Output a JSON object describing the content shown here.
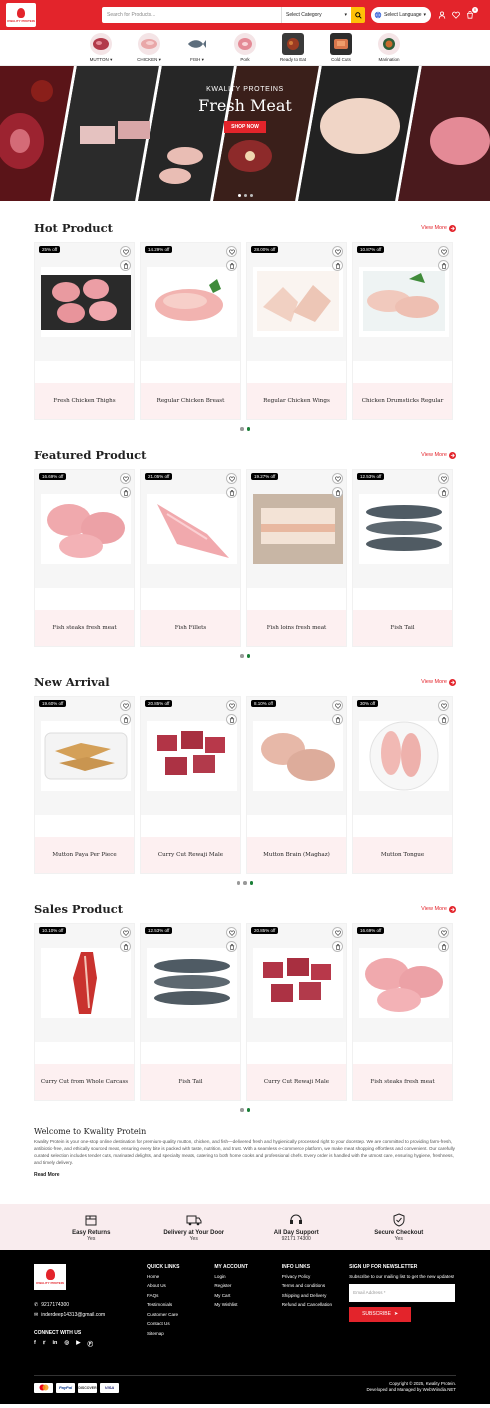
{
  "header": {
    "logo_text": "KWALITY PROTEIN",
    "search_placeholder": "Search for Products...",
    "category_select": "Select Category",
    "language_select": "Select Language",
    "cart_count": "0"
  },
  "categories": [
    {
      "label": "MUTTON"
    },
    {
      "label": "CHICKEN"
    },
    {
      "label": "FISH"
    },
    {
      "label": "Pork"
    },
    {
      "label": "Ready to Eat"
    },
    {
      "label": "Cold Cuts"
    },
    {
      "label": "Marination"
    }
  ],
  "hero": {
    "subtitle": "KWALITY PROTEINS",
    "title": "Fresh Meat",
    "button": "SHOP NOW"
  },
  "sections": [
    {
      "title": "Hot Product",
      "view_more": "View More",
      "products": [
        {
          "badge": "25% off",
          "name": "Fresh Chicken Thighs"
        },
        {
          "badge": "14.29% off",
          "name": "Regular Chicken Breast"
        },
        {
          "badge": "28.00% off",
          "name": "Regular Chicken Wings"
        },
        {
          "badge": "10.87% off",
          "name": "Chicken Drumsticks Regular"
        }
      ]
    },
    {
      "title": "Featured Product",
      "view_more": "View More",
      "products": [
        {
          "badge": "16.69% off",
          "name": "Fish steaks fresh meat"
        },
        {
          "badge": "21.05% off",
          "name": "Fish Fillets"
        },
        {
          "badge": "19.27% off",
          "name": "Fish loins fresh meat"
        },
        {
          "badge": "12.53% off",
          "name": "Fish Tail"
        }
      ]
    },
    {
      "title": "New Arrival",
      "view_more": "View More",
      "products": [
        {
          "badge": "19.60% off",
          "name": "Mutton Paya Per Piece"
        },
        {
          "badge": "20.85% off",
          "name": "Curry Cut Rewaji Male"
        },
        {
          "badge": "8.10% off",
          "name": "Mutton Brain (Maghaz)"
        },
        {
          "badge": "30% off",
          "name": "Mutton Tongue"
        }
      ]
    },
    {
      "title": "Sales Product",
      "view_more": "View More",
      "products": [
        {
          "badge": "10.10% off",
          "name": "Curry Cut from Whole Carcass"
        },
        {
          "badge": "12.53% off",
          "name": "Fish Tail"
        },
        {
          "badge": "20.85% off",
          "name": "Curry Cut Rewaji Male"
        },
        {
          "badge": "16.69% off",
          "name": "Fish steaks fresh meat"
        }
      ]
    }
  ],
  "welcome": {
    "title": "Welcome to Kwality Protein",
    "body": "Kwality Protein is your one-stop online destination for premium-quality mutton, chicken, and fish—delivered fresh and hygienically processed right to your doorstep. We are committed to providing farm-fresh, antibiotic-free, and ethically sourced meat, ensuring every bite is packed with taste, nutrition, and trust. With a seamless e-commerce platform, we make meat shopping effortless and convenient. Our carefully curated selection includes tender cuts, marinated delights, and specialty meats, catering to both home cooks and professional chefs. Every order is handled with the utmost care, ensuring hygiene, freshness, and timely delivery.",
    "read_more": "Read More"
  },
  "features": [
    {
      "title": "Easy Returns",
      "sub": "Yes"
    },
    {
      "title": "Delivery at Your Door",
      "sub": "Yes"
    },
    {
      "title": "All Day Support",
      "sub": "92171 74300"
    },
    {
      "title": "Secure Checkout",
      "sub": "Yes"
    }
  ],
  "footer": {
    "phone": "9217174300",
    "email": "inderdeep14313@gmail.com",
    "connect": "CONNECT WITH US",
    "quick_links_title": "QUICK LINKS",
    "quick_links": [
      "Home",
      "About Us",
      "FAQs",
      "Testimonials",
      "Customer Care",
      "Contact Us",
      "Sitemap"
    ],
    "account_title": "MY ACCOUNT",
    "account_links": [
      "Login",
      "Register",
      "My Cart",
      "My Wishlist"
    ],
    "info_title": "INFO LINKS",
    "info_links": [
      "Privacy Policy",
      "Terms and conditions",
      "Shipping and Delivery",
      "Refund and Cancellation"
    ],
    "newsletter_title": "SIGN UP FOR NEWSLETTER",
    "newsletter_text": "Subscribe to our mailing list to get the new updates!",
    "email_placeholder": "Email Address *",
    "subscribe": "SUBSCRIBE",
    "payments": [
      "mastercard",
      "PayPal",
      "DISCOVER",
      "VISA"
    ],
    "copyright": "Copyright © 2025, Kwality Protein.",
    "managed": "Developed and Managed by WebWiindia.NET"
  },
  "colors": {
    "brand": "#e3242b",
    "pale": "#fdf0f1"
  }
}
